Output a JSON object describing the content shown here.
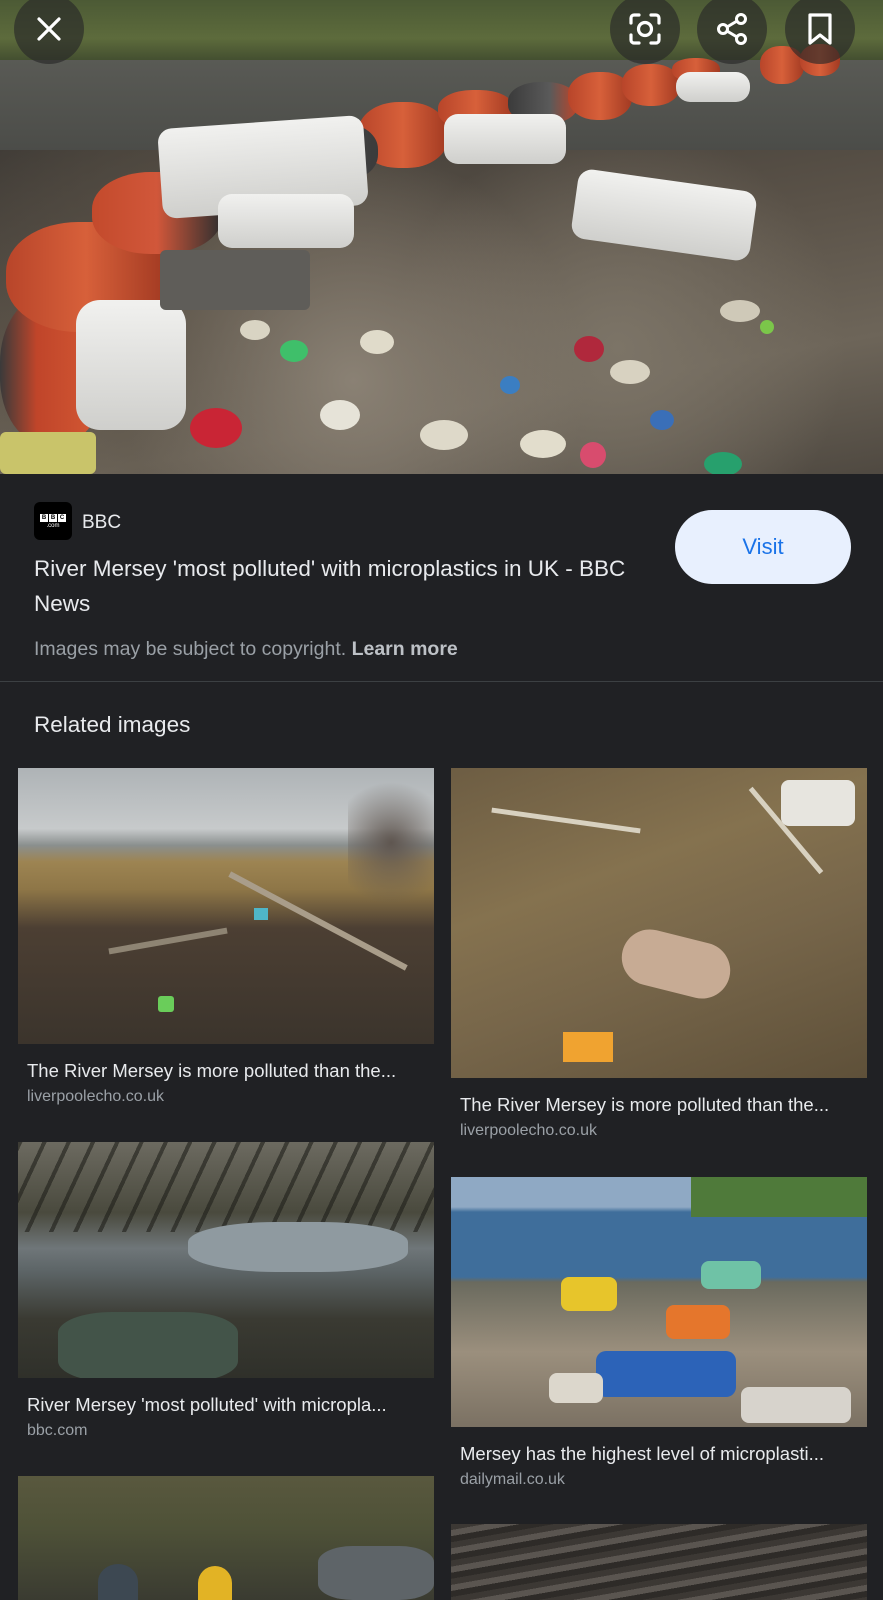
{
  "toolbar": {
    "close_icon": "close-icon",
    "lens_icon": "lens-icon",
    "share_icon": "share-icon",
    "bookmark_icon": "bookmark-icon"
  },
  "source": {
    "name": "BBC",
    "logo_letters": [
      "B",
      "B",
      "C"
    ],
    "logo_sub": ".com",
    "title": "River Mersey 'most polluted' with microplastics in UK - BBC News",
    "visit_label": "Visit",
    "copyright_text": "Images may be subject to copyright.",
    "learn_more": "Learn more"
  },
  "related": {
    "heading": "Related images",
    "items": [
      {
        "title": "The River Mersey is more polluted than the...",
        "domain": "liverpoolecho.co.uk"
      },
      {
        "title": "The River Mersey is more polluted than the...",
        "domain": "liverpoolecho.co.uk"
      },
      {
        "title": "River Mersey 'most polluted' with micropla...",
        "domain": "bbc.com"
      },
      {
        "title": "Mersey has the highest level of microplasti...",
        "domain": "dailymail.co.uk"
      }
    ]
  },
  "colors": {
    "background": "#202124",
    "visit_bg": "#e8f0fe",
    "visit_text": "#1a73e8",
    "secondary_text": "#9aa0a6"
  }
}
